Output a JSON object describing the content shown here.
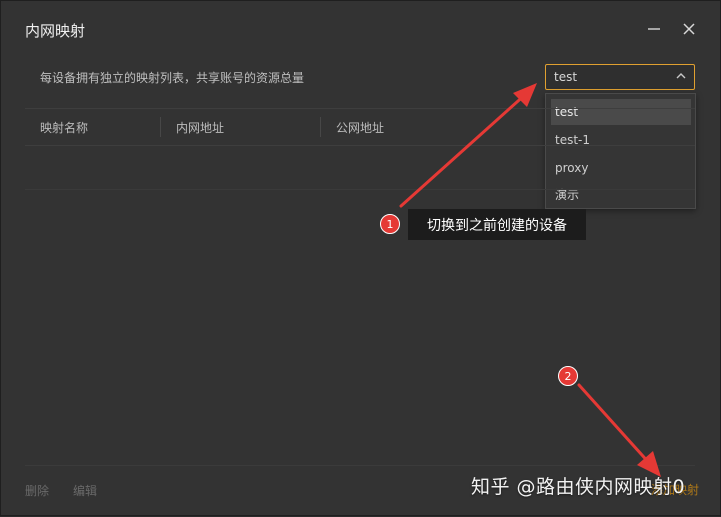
{
  "window": {
    "title": "内网映射"
  },
  "header": {
    "subtitle": "每设备拥有独立的映射列表，共享账号的资源总量"
  },
  "device_select": {
    "selected": "test",
    "options": [
      "test",
      "test-1",
      "proxy",
      "演示"
    ]
  },
  "table": {
    "columns": [
      "映射名称",
      "内网地址",
      "公网地址"
    ]
  },
  "footer": {
    "delete_label": "删除",
    "edit_label": "编辑",
    "add_label": "添加映射"
  },
  "annotations": {
    "step1_number": "1",
    "step1_text": "切换到之前创建的设备",
    "step2_number": "2"
  },
  "watermark": {
    "text": "知乎 @路由侠内网映射0"
  },
  "colors": {
    "accent": "#e0a030",
    "annotation_red": "#e53935",
    "window_bg": "#333333"
  }
}
